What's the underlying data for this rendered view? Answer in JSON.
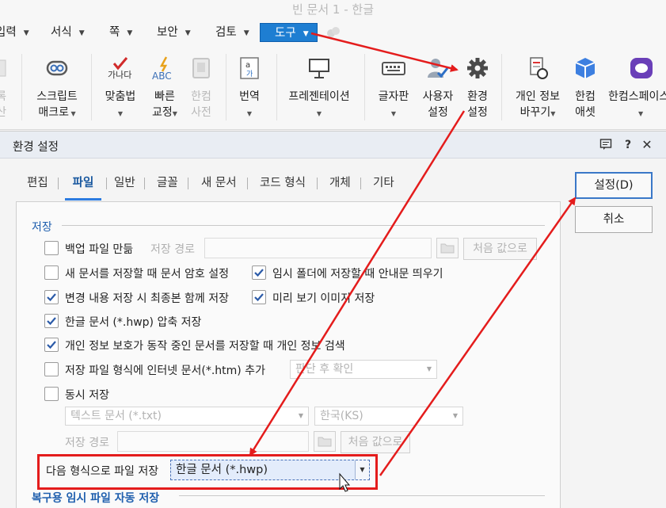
{
  "window": {
    "title": "빈 문서 1 - 한글"
  },
  "menu": {
    "items": [
      {
        "label": "입력"
      },
      {
        "label": "서식"
      },
      {
        "label": "쪽"
      },
      {
        "label": "보안"
      },
      {
        "label": "검토"
      },
      {
        "label": "도구",
        "active": true
      }
    ]
  },
  "ribbon": {
    "buttons": [
      {
        "line1": "스크립트",
        "line2": "매크로",
        "icon": "macro-icon"
      },
      {
        "line1": "맞춤법",
        "line2": "",
        "icon": "spellcheck-icon",
        "icon_text": "가나다"
      },
      {
        "line1": "빠른",
        "line2": "교정",
        "icon": "quick-correct-icon",
        "icon_text": "ABC"
      },
      {
        "line1": "한컴",
        "line2": "사전",
        "icon": "dictionary-icon"
      },
      {
        "line1": "번역",
        "line2": "",
        "icon": "translate-icon"
      },
      {
        "line1": "프레젠테이션",
        "line2": "",
        "icon": "presentation-icon"
      },
      {
        "line1": "글자판",
        "line2": "",
        "icon": "keyboard-icon"
      },
      {
        "line1": "사용자",
        "line2": "설정",
        "icon": "user-settings-icon"
      },
      {
        "line1": "환경",
        "line2": "설정",
        "icon": "gear-icon"
      },
      {
        "line1": "개인 정보",
        "line2": "바꾸기",
        "icon": "privacy-icon"
      },
      {
        "line1": "한컴",
        "line2": "애셋",
        "icon": "asset-icon"
      },
      {
        "line1": "한컴스페이스",
        "line2": "",
        "icon": "hancom-space-icon"
      }
    ],
    "partial_left": {
      "line1": "록",
      "line2": "산"
    }
  },
  "dialog": {
    "title": "환경 설정",
    "tabs": [
      "편집",
      "파일",
      "일반",
      "글꼴",
      "새 문서",
      "코드 형식",
      "개체",
      "기타"
    ],
    "active_tab": "파일",
    "buttons": {
      "ok": "설정(D)",
      "cancel": "취소"
    },
    "save_section": {
      "label": "저장",
      "backup": {
        "label": "백업 파일 만듦",
        "checked": false,
        "path_label": "저장 경로",
        "default_button": "처음 값으로"
      },
      "encrypt": {
        "label": "새 문서를 저장할 때 문서 암호 설정",
        "checked": false
      },
      "temp_notice": {
        "label": "임시 폴더에 저장할 때 안내문 띄우기",
        "checked": true
      },
      "final_version": {
        "label": "변경 내용 저장 시 최종본 함께 저장",
        "checked": true
      },
      "preview_image": {
        "label": "미리 보기 이미지 저장",
        "checked": true
      },
      "compress": {
        "label": "한글 문서 (*.hwp) 압축 저장",
        "checked": true
      },
      "privacy_search": {
        "label": "개인 정보 보호가 동작 중인 문서를 저장할 때 개인 정보 검색",
        "checked": true
      },
      "internet_format": {
        "label": "저장 파일 형식에 인터넷 문서(*.htm) 추가",
        "checked": false,
        "combo": "판단 후 확인"
      },
      "simultaneous": {
        "label": "동시 저장",
        "checked": false,
        "format_combo": "텍스트 문서 (*.txt)",
        "encoding_combo": "한국(KS)",
        "path_label": "저장 경로",
        "default_button": "처음 값으로"
      },
      "save_as_format": {
        "label": "다음 형식으로 파일 저장",
        "value": "한글 문서 (*.hwp)"
      }
    },
    "recovery_section": {
      "label": "복구용 임시 파일 자동 저장"
    }
  },
  "colors": {
    "accent": "#1e7ed2",
    "annotation": "#e41c1c",
    "section": "#1f5fae"
  }
}
